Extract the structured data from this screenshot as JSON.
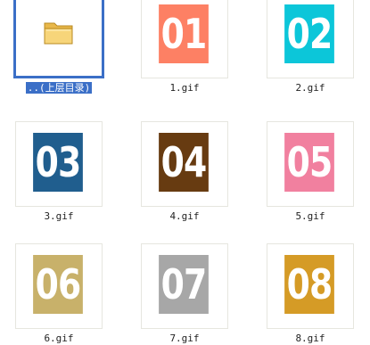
{
  "items": [
    {
      "name": "..(上层目录)",
      "kind": "folder",
      "icon": "folder-icon",
      "selected": true
    },
    {
      "name": "1.gif",
      "tile": "01",
      "color": "#fd8064"
    },
    {
      "name": "2.gif",
      "tile": "02",
      "color": "#0cc6d9"
    },
    {
      "name": "3.gif",
      "tile": "03",
      "color": "#205e8e"
    },
    {
      "name": "4.gif",
      "tile": "04",
      "color": "#673b11"
    },
    {
      "name": "5.gif",
      "tile": "05",
      "color": "#f1809f"
    },
    {
      "name": "6.gif",
      "tile": "06",
      "color": "#c8b16a"
    },
    {
      "name": "7.gif",
      "tile": "07",
      "color": "#a7a7a7"
    },
    {
      "name": "8.gif",
      "tile": "08",
      "color": "#d59b26"
    }
  ]
}
